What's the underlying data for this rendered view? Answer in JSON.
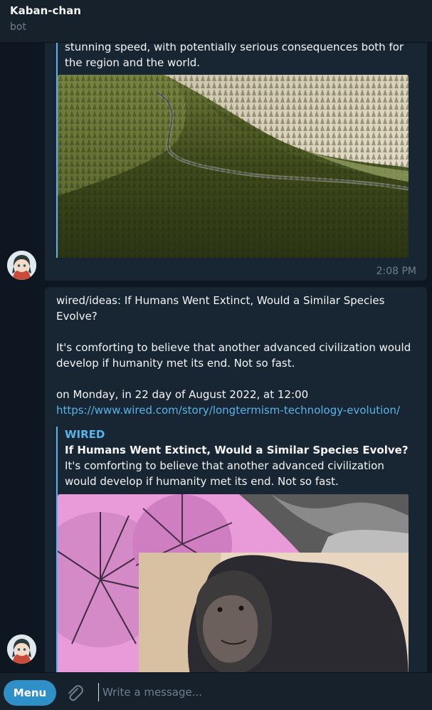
{
  "header": {
    "title": "Kaban-chan",
    "status": "bot"
  },
  "messages": [
    {
      "text_tail": "stunning speed, with potentially serious consequences both for the region and the world.",
      "image": "aerial-forest-desert-photo",
      "time": "2:08 PM"
    },
    {
      "headline": "wired/ideas: If Humans Went Extinct, Would a Similar Species Evolve?",
      "summary": "It's comforting to believe that another advanced civilization would develop if humanity met its end. Not so fast.",
      "date": "on Monday, in 22 day of August 2022, at 12:00",
      "url": "https://www.wired.com/story/longtermism-technology-evolution/",
      "preview": {
        "site": "WIRED",
        "title": "If Humans Went Extinct, Would a Similar Species Evolve?",
        "description": "It's comforting to believe that another advanced civilization would develop if humanity met its end. Not so fast.",
        "image": "chimpanzee-collage-photo"
      }
    }
  ],
  "composer": {
    "menu_label": "Menu",
    "placeholder": "Write a message..."
  },
  "colors": {
    "accent": "#5ab2e6",
    "bubble": "#182533",
    "background": "#0e1621",
    "header": "#17212b",
    "button": "#2f8fc7"
  }
}
